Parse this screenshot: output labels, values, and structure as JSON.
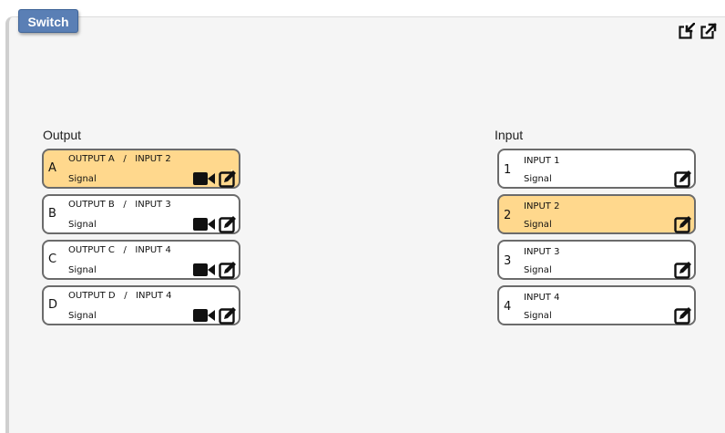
{
  "header": {
    "tab_label": "Switch",
    "icons": [
      "import-icon",
      "export-icon"
    ]
  },
  "output": {
    "title": "Output",
    "items": [
      {
        "letter": "A",
        "output": "OUTPUT A",
        "separator": "/",
        "input": "INPUT 2",
        "signal": "Signal",
        "active": true
      },
      {
        "letter": "B",
        "output": "OUTPUT B",
        "separator": "/",
        "input": "INPUT 3",
        "signal": "Signal",
        "active": false
      },
      {
        "letter": "C",
        "output": "OUTPUT C",
        "separator": "/",
        "input": "INPUT 4",
        "signal": "Signal",
        "active": false
      },
      {
        "letter": "D",
        "output": "OUTPUT D",
        "separator": "/",
        "input": "INPUT 4",
        "signal": "Signal",
        "active": false
      }
    ]
  },
  "input": {
    "title": "Input",
    "items": [
      {
        "number": "1",
        "label": "INPUT 1",
        "signal": "Signal",
        "active": false
      },
      {
        "number": "2",
        "label": "INPUT 2",
        "signal": "Signal",
        "active": true
      },
      {
        "number": "3",
        "label": "INPUT 3",
        "signal": "Signal",
        "active": false
      },
      {
        "number": "4",
        "label": "INPUT 4",
        "signal": "Signal",
        "active": false
      }
    ]
  },
  "colors": {
    "tab": "#5a7fb5",
    "active_card": "#ffd88d",
    "card_border": "#6b6b6b",
    "panel_bg": "#f5f5f5"
  }
}
